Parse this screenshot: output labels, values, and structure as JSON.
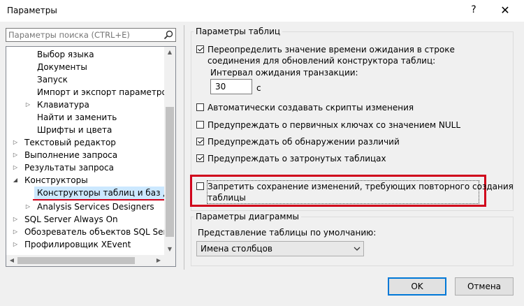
{
  "window": {
    "title": "Параметры",
    "help": "?",
    "close": "✕"
  },
  "search": {
    "placeholder": "Параметры поиска (CTRL+E)"
  },
  "tree": {
    "items": [
      {
        "label": "Выбор языка"
      },
      {
        "label": "Документы"
      },
      {
        "label": "Запуск"
      },
      {
        "label": "Импорт и экспорт параметров"
      },
      {
        "label": "Клавиатура",
        "expander": "▷"
      },
      {
        "label": "Найти и заменить"
      },
      {
        "label": "Шрифты и цвета"
      },
      {
        "label": "Текстовый редактор",
        "expander": "▷"
      },
      {
        "label": "Выполнение запроса",
        "expander": "▷"
      },
      {
        "label": "Результаты запроса",
        "expander": "▷"
      },
      {
        "label": "Конструкторы",
        "expander": "◢"
      },
      {
        "label": "Конструкторы таблиц и баз данн"
      },
      {
        "label": "Analysis Services Designers",
        "expander": "▷"
      },
      {
        "label": "SQL Server Always On",
        "expander": "▷"
      },
      {
        "label": "Обозреватель объектов SQL Server",
        "expander": "▷"
      },
      {
        "label": "Профилировщик XEvent",
        "expander": "▷"
      }
    ]
  },
  "table_options": {
    "legend": "Параметры таблиц",
    "override_timeout": {
      "label": "Переопределить значение времени ожидания в строке",
      "label2": "соединения для обновлений конструктора таблиц:",
      "checked": true
    },
    "interval_label": "Интервал ожидания транзакции:",
    "interval_value": "30",
    "interval_unit": "с",
    "auto_scripts": {
      "label": "Автоматически создавать скрипты изменения",
      "checked": false
    },
    "warn_null_pk": {
      "label": "Предупреждать о первичных ключах со значением NULL",
      "checked": false
    },
    "warn_diff": {
      "label": "Предупреждать об обнаружении различий",
      "checked": true
    },
    "warn_affected": {
      "label": "Предупреждать о затронутых таблицах",
      "checked": true
    },
    "prevent_save": {
      "label": "Запретить сохранение изменений, требующих повторного создания",
      "label2": "таблицы",
      "checked": false
    }
  },
  "diagram_options": {
    "legend": "Параметры диаграммы",
    "view_label": "Представление таблицы по умолчанию:",
    "view_value": "Имена столбцов"
  },
  "buttons": {
    "ok": "OK",
    "cancel": "Отмена"
  },
  "colors": {
    "highlight": "#d0021b",
    "selection": "#cce8ff",
    "accent": "#0078d7"
  }
}
